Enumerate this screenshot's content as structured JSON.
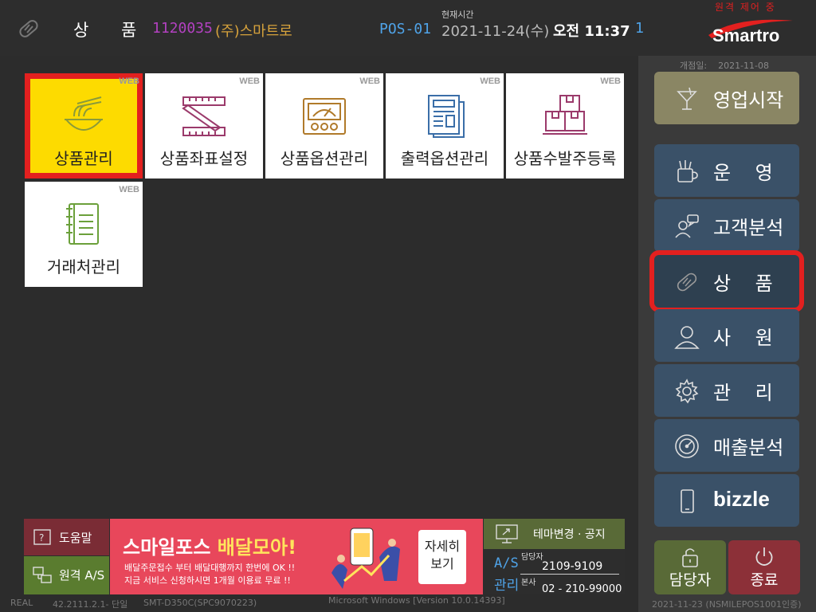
{
  "header": {
    "title_char1": "상",
    "title_char2": "품",
    "store_code": "1120035",
    "store_name": "(주)스마트로",
    "pos_id": "POS-01",
    "time_label": "현재시간",
    "date": "2021-11-24(수)",
    "time": "오전 11:37",
    "tick": "1",
    "remote_status": "원격 제어 중",
    "logo": "Smartro"
  },
  "tiles": [
    {
      "label": "상품관리",
      "badge": "WEB",
      "icon": "noodle-bowl-icon",
      "selected": true
    },
    {
      "label": "상품좌표설정",
      "badge": "WEB",
      "icon": "ruler-icon"
    },
    {
      "label": "상품옵션관리",
      "badge": "WEB",
      "icon": "gauge-panel-icon"
    },
    {
      "label": "출력옵션관리",
      "badge": "WEB",
      "icon": "newspaper-icon"
    },
    {
      "label": "상품수발주등록",
      "badge": "WEB",
      "icon": "boxes-icon"
    },
    {
      "label": "거래처관리",
      "badge": "WEB",
      "icon": "ledger-book-icon"
    }
  ],
  "sidebar": {
    "open_date_label": "개점일:",
    "open_date": "2021-11-08",
    "items": [
      {
        "label": "영업시작",
        "icon": "cocktail-icon"
      },
      {
        "label": "운    영",
        "icon": "tools-cup-icon"
      },
      {
        "label": "고객분석",
        "icon": "customer-chat-icon"
      },
      {
        "label": "상    품",
        "icon": "product-tag-icon"
      },
      {
        "label": "사    원",
        "icon": "person-icon"
      },
      {
        "label": "관    리",
        "icon": "gear-icon"
      },
      {
        "label": "매출분석",
        "icon": "speedometer-icon"
      },
      {
        "label": "bizzle",
        "icon": "smartphone-icon"
      }
    ],
    "manager_label": "담당자",
    "exit_label": "종료"
  },
  "bottom": {
    "help_label": "도움말",
    "remote_label": "원격 A/S",
    "banner_title_part1": "스마일포스",
    "banner_title_part2": "배달모아!",
    "banner_line1": "배달주문접수 부터 배달대행까지 한번에 OK !!",
    "banner_line2": "지금 서비스 신청하시면 1개월 이용료 무료 !!",
    "banner_more_line1": "자세히",
    "banner_more_line2": "보기",
    "theme_label": "테마변경 · 공지",
    "as_label1": "A/S",
    "as_label2": "관리",
    "as_key1": "담당자",
    "as_val1": "2109-9109",
    "as_key2": "본사",
    "as_val2": "02 - 210-99000"
  },
  "status_bar": {
    "mode": "REAL",
    "version": "42.2111.2.1- 단일",
    "device": "SMT-D350C(SPC9070223)",
    "os": "Microsoft Windows [Version 10.0.14393]",
    "build": "2021-11-23 (NSMILEPOS1001인증)"
  },
  "colors": {
    "accent_red": "#e3201f",
    "selected_tile": "#fddb00",
    "sidebar_button": "#3a5168",
    "start_button": "#8a8664"
  }
}
